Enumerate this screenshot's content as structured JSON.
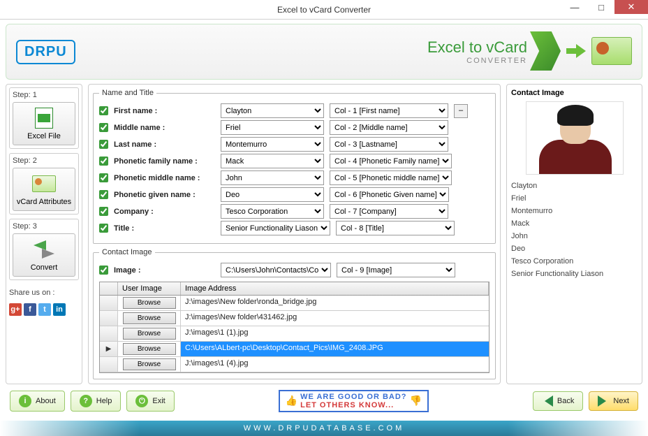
{
  "window": {
    "title": "Excel to vCard Converter"
  },
  "logo": "DRPU",
  "banner": {
    "title": "Excel to vCard",
    "subtitle": "CONVERTER"
  },
  "steps": {
    "step1": {
      "label": "Step: 1",
      "btn": "Excel File"
    },
    "step2": {
      "label": "Step: 2",
      "btn": "vCard Attributes"
    },
    "step3": {
      "label": "Step: 3",
      "btn": "Convert"
    },
    "share_label": "Share us on :"
  },
  "name_title": {
    "legend": "Name and Title",
    "rows": [
      {
        "label": "First name :",
        "value": "Clayton",
        "col": "Col - 1 [First name]"
      },
      {
        "label": "Middle name :",
        "value": "Friel",
        "col": "Col - 2 [Middle name]"
      },
      {
        "label": "Last name :",
        "value": "Montemurro",
        "col": "Col - 3 [Lastname]"
      },
      {
        "label": "Phonetic family name :",
        "value": "Mack",
        "col": "Col - 4 [Phonetic Family name]"
      },
      {
        "label": "Phonetic middle name :",
        "value": "John",
        "col": "Col - 5 [Phonetic middle name]"
      },
      {
        "label": "Phonetic given name :",
        "value": "Deo",
        "col": "Col - 6 [Phonetic Given name]"
      },
      {
        "label": "Company :",
        "value": "Tesco Corporation",
        "col": "Col - 7 [Company]"
      },
      {
        "label": "Title :",
        "value": "Senior Functionality Liason",
        "col": "Col - 8 [Title]"
      }
    ]
  },
  "contact_image": {
    "legend": "Contact Image",
    "label": "Image :",
    "value": "C:\\Users\\John\\Contacts\\Co",
    "col": "Col - 9 [Image]",
    "headers": {
      "user_image": "User Image",
      "image_address": "Image Address"
    },
    "browse": "Browse",
    "rows": [
      {
        "addr": "J:\\images\\New folder\\ronda_bridge.jpg",
        "selected": false
      },
      {
        "addr": "J:\\images\\New folder\\431462.jpg",
        "selected": false
      },
      {
        "addr": "J:\\images\\1 (1).jpg",
        "selected": false
      },
      {
        "addr": "C:\\Users\\ALbert-pc\\Desktop\\Contact_Pics\\IMG_2408.JPG",
        "selected": true
      },
      {
        "addr": "J:\\images\\1 (4).jpg",
        "selected": false
      }
    ]
  },
  "preview": {
    "label": "Contact Image",
    "values": [
      "Clayton",
      "Friel",
      "Montemurro",
      "Mack",
      "John",
      "Deo",
      "Tesco Corporation",
      "Senior Functionality Liason"
    ]
  },
  "footer": {
    "about": "About",
    "help": "Help",
    "exit": "Exit",
    "rate1": "WE ARE GOOD OR BAD?",
    "rate2": "LET OTHERS KNOW...",
    "back": "Back",
    "next": "Next"
  },
  "url": "WWW.DRPUDATABASE.COM"
}
